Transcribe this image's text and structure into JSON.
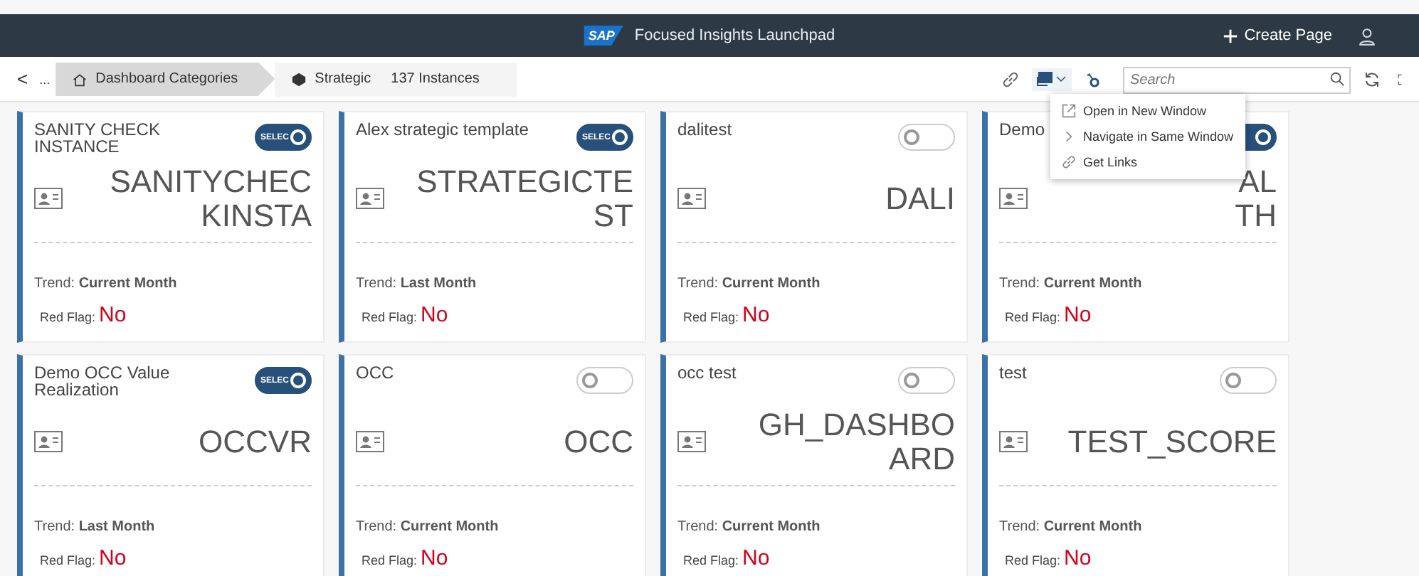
{
  "header": {
    "logo": "SAP",
    "title": "Focused Insights Launchpad",
    "create_button": "Create Page"
  },
  "toolbar": {
    "back": "<",
    "overflow": "...",
    "breadcrumbs": [
      {
        "label": "Dashboard Categories",
        "selected": false
      },
      {
        "label": "Strategic",
        "selected": true
      }
    ],
    "count": "137 Instances",
    "search": {
      "placeholder": "Search"
    }
  },
  "menu": {
    "items": [
      {
        "kind": "open",
        "label": "Open in New Window"
      },
      {
        "kind": "navigate",
        "label": "Navigate in Same Window"
      },
      {
        "kind": "link",
        "label": "Get Links"
      }
    ]
  },
  "cards": [
    {
      "title": "SANITY CHECK INSTANCE",
      "toggle": {
        "on": true,
        "label": "SELEC"
      },
      "code_lines": [
        "SANITYCHEC",
        "KINSTA"
      ],
      "trend_label": "Trend:",
      "trend": "Current Month",
      "flag_label": "Red Flag:",
      "flag": "No"
    },
    {
      "title": "Alex strategic template",
      "toggle": {
        "on": true,
        "label": "SELEC"
      },
      "code_lines": [
        "STRATEGICTE",
        "ST"
      ],
      "trend_label": "Trend:",
      "trend": "Last Month",
      "flag_label": "Red Flag:",
      "flag": "No"
    },
    {
      "title": "dalitest",
      "toggle": {
        "on": false
      },
      "code_lines": [
        "DALI"
      ],
      "trend_label": "Trend:",
      "trend": "Current Month",
      "flag_label": "Red Flag:",
      "flag": "No"
    },
    {
      "title": "Demo",
      "toggle": {
        "on": true
      },
      "code_lines": [
        "AL",
        "TH"
      ],
      "trend_label": "Trend:",
      "trend": "Current Month",
      "flag_label": "Red Flag:",
      "flag": "No"
    },
    {
      "title": "Demo OCC Value Realization",
      "toggle": {
        "on": true,
        "label": "SELEC"
      },
      "code_lines": [
        "OCCVR"
      ],
      "trend_label": "Trend:",
      "trend": "Last Month",
      "flag_label": "Red Flag:",
      "flag": "No"
    },
    {
      "title": "OCC",
      "toggle": {
        "on": false
      },
      "code_lines": [
        "OCC"
      ],
      "trend_label": "Trend:",
      "trend": "Current Month",
      "flag_label": "Red Flag:",
      "flag": "No"
    },
    {
      "title": "occ test",
      "toggle": {
        "on": false
      },
      "code_lines": [
        "GH_DASHBO",
        "ARD"
      ],
      "trend_label": "Trend:",
      "trend": "Current Month",
      "flag_label": "Red Flag:",
      "flag": "No"
    },
    {
      "title": "test",
      "toggle": {
        "on": false
      },
      "code_lines": [
        "TEST_SCORE"
      ],
      "trend_label": "Trend:",
      "trend": "Current Month",
      "flag_label": "Red Flag:",
      "flag": "No"
    }
  ]
}
